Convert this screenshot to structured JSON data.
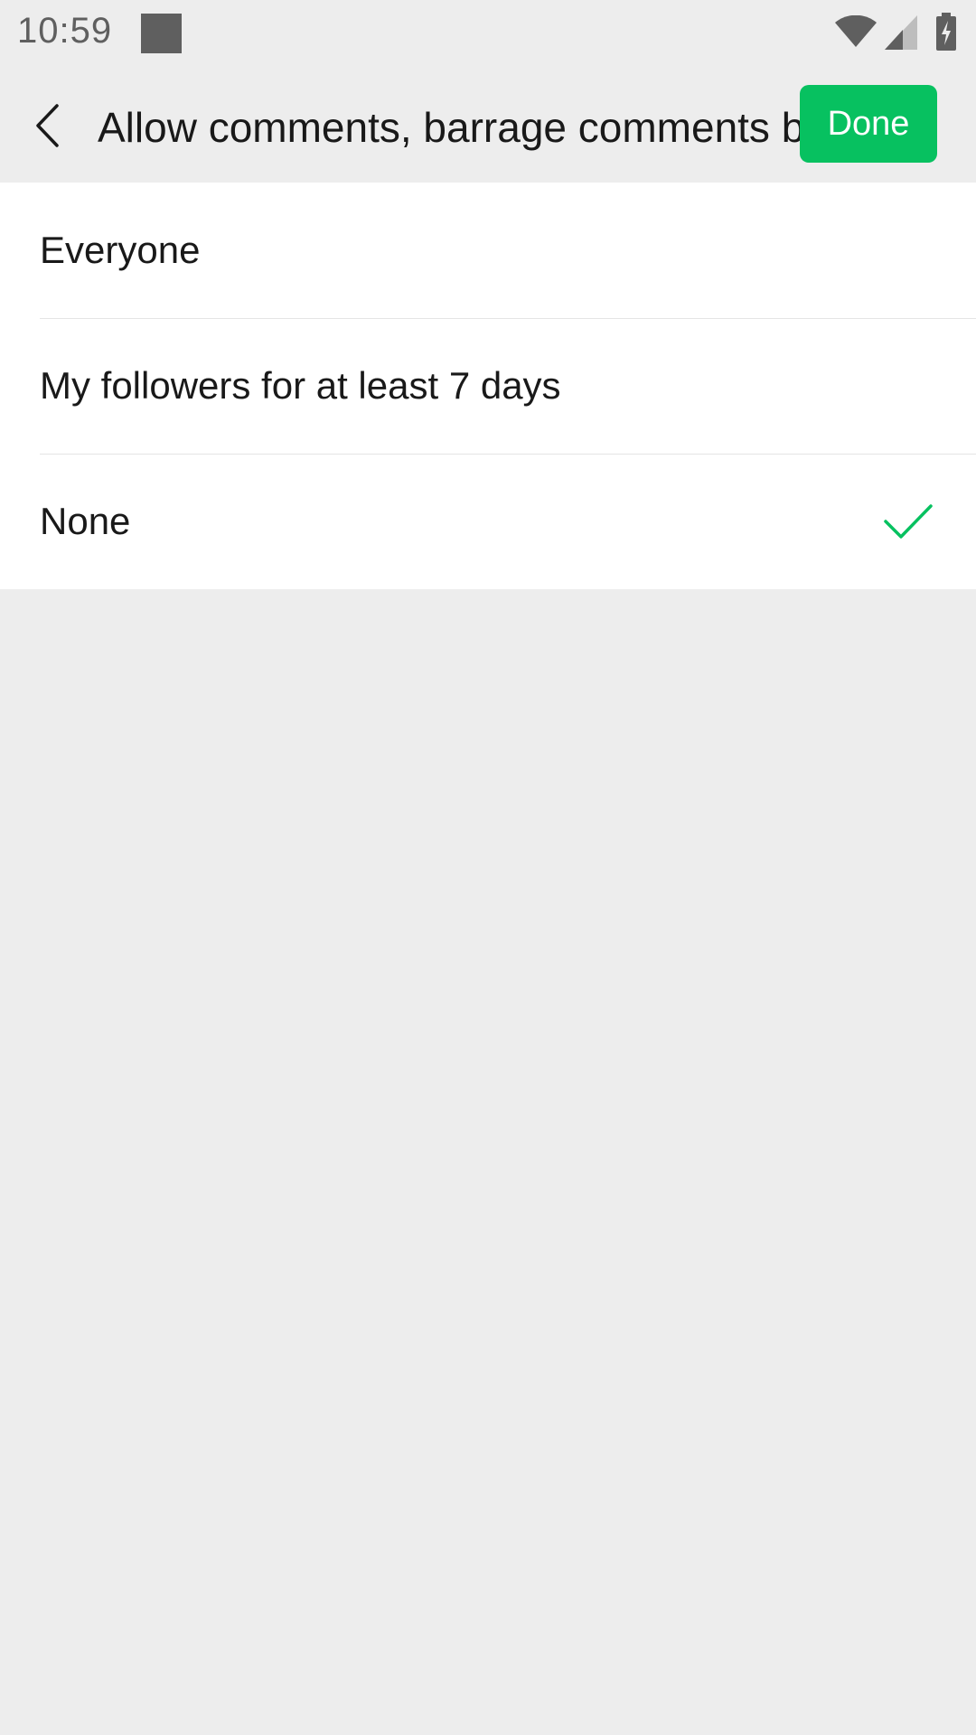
{
  "status_bar": {
    "time": "10:59",
    "notification_icon": "app-notification-icon",
    "wifi_icon": "wifi-icon",
    "signal_icon": "cell-signal-icon",
    "battery_icon": "battery-charging-icon",
    "icon_color": "#5f5f5f"
  },
  "header": {
    "back_icon": "chevron-left-icon",
    "title": "Allow comments, barrage comments b",
    "done_label": "Done",
    "done_color": "#07c160"
  },
  "options": [
    {
      "label": "Everyone",
      "selected": false
    },
    {
      "label": "My followers for at least 7 days",
      "selected": false
    },
    {
      "label": "None",
      "selected": true
    }
  ],
  "check_icon": "checkmark-icon",
  "check_color": "#07c160",
  "background_color": "#ededed"
}
